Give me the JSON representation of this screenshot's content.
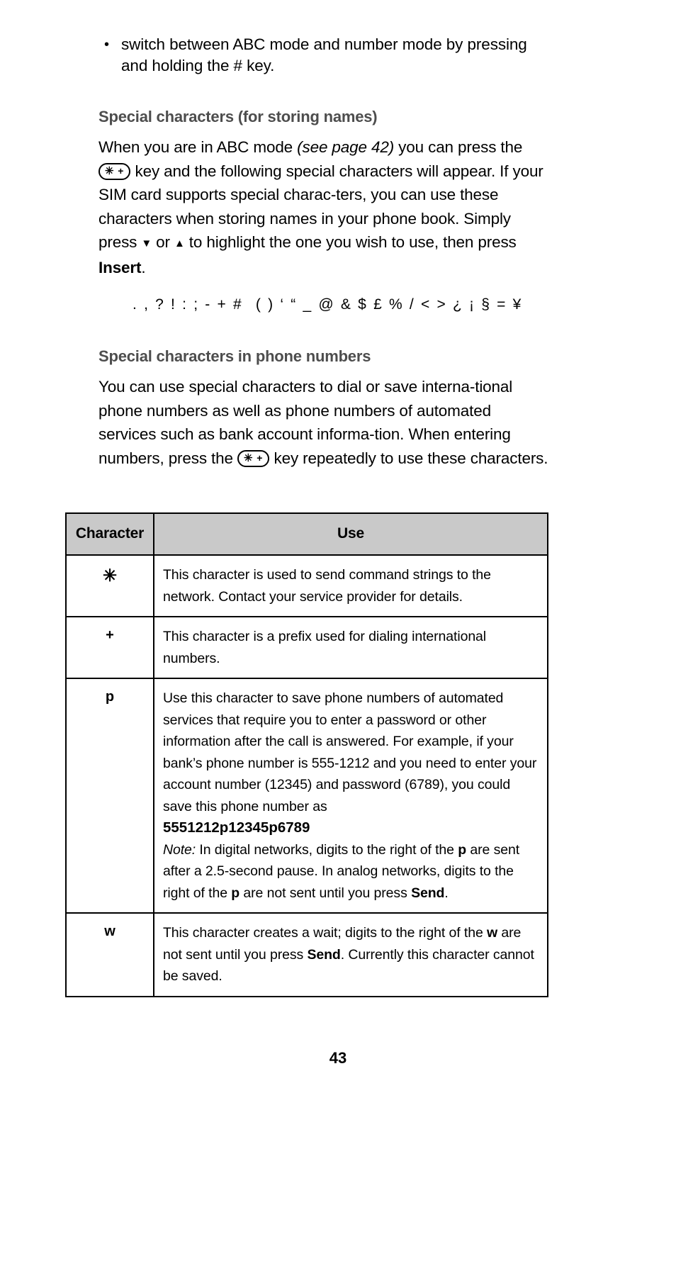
{
  "document": {
    "page_number": "43"
  },
  "bullet_list": {
    "items": [
      "switch between ABC mode and number mode by pressing and holding the # key."
    ]
  },
  "section_storing_names": {
    "heading": "Special characters (for storing names)",
    "paragraph": {
      "part1": "When you are in ABC mode ",
      "italic1": "(see page 42)",
      "part2": " you can press the ",
      "key_glyph": {
        "star": "✳",
        "plus": "+"
      },
      "part3": " key and the following special characters will appear. If your SIM card supports special charac-ters, you can use these characters when storing names in your phone book. Simply press ",
      "arrow_down": "▼",
      "part4": " or ",
      "arrow_up": "▲",
      "part5": " to highlight the one you wish to use, then press ",
      "bold1": "Insert",
      "part6": "."
    },
    "special_characters": {
      "group1": ". , ? ! : ; - + #",
      "group2": "( ) ‘ “ _ @ & $ £ % / < > ¿ ¡ § = ¥"
    }
  },
  "section_phone_numbers": {
    "heading": "Special characters in phone numbers",
    "paragraph": {
      "part1": "You can use special characters to dial or save interna-tional phone numbers as well as phone numbers of automated services such as bank account informa-tion. When entering numbers, press the ",
      "key_glyph": {
        "star": "✳",
        "plus": "+"
      },
      "part2": " key repeatedly to use these characters."
    }
  },
  "table": {
    "headers": {
      "character": "Character",
      "use": "Use"
    },
    "rows": [
      {
        "character": "✳",
        "use": {
          "text": "This character is used to send command strings to the network. Contact your service provider for details."
        }
      },
      {
        "character": "+",
        "use": {
          "text": "This character is a prefix used for dialing international numbers."
        }
      },
      {
        "character": "p",
        "use": {
          "part1": "Use this character to save phone numbers of automated services that require you to enter a password or other information after the call is answered. For example, if your bank’s phone number is 555-1212 and you need to enter your account number (12345) and password (6789), you could save this phone number as",
          "phone_bold": "5551212p12345p6789",
          "note_label": "Note:",
          "note_part1": " In digital networks, digits to the right of the ",
          "note_bold1": "p",
          "note_part2": " are sent after a 2.5-second pause. In analog networks, digits to the right of the ",
          "note_bold2": "p",
          "note_part3": " are not sent until you press ",
          "note_bold3": "Send",
          "note_part4": "."
        }
      },
      {
        "character": "w",
        "use": {
          "part1": "This character creates a wait; digits to the right of the ",
          "bold1": "w",
          "part2": " are not sent until you press ",
          "bold2": "Send",
          "part3": ". Currently this character cannot be saved."
        }
      }
    ]
  },
  "colors": {
    "heading": "#4d4d4d",
    "table_header_bg": "#c9c9c9",
    "text": "#000000",
    "border": "#000000"
  }
}
